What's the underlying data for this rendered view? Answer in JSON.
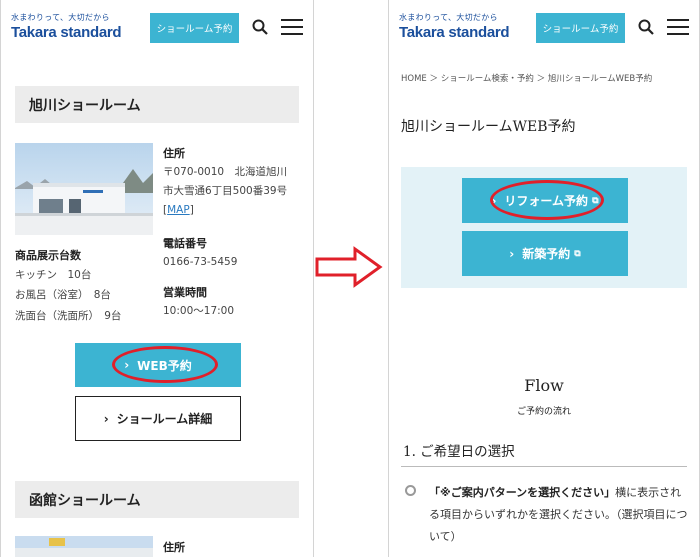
{
  "header": {
    "tagline": "水まわりって、大切だから",
    "logo": "Takara standard",
    "reserve_button": "ショールーム予約"
  },
  "left": {
    "showrooms": [
      {
        "title": "旭川ショールーム",
        "address_label": "住所",
        "address_lines": [
          "〒070-0010　北海道旭川",
          "市大雪通6丁目500番39号"
        ],
        "map_link": "MAP",
        "phone_label": "電話番号",
        "phone": "0166-73-5459",
        "hours_label": "営業時間",
        "hours": "10:00〜17:00",
        "display_label": "商品展示台数",
        "display_items": [
          "キッチン　10台",
          "お風呂（浴室）　8台",
          "洗面台（洗面所）　9台"
        ]
      },
      {
        "title": "函館ショールーム",
        "address_label": "住所"
      }
    ],
    "web_reserve_button": "WEB予約",
    "detail_button": "ショールーム詳細"
  },
  "right": {
    "breadcrumb": "HOME ＞ ショールーム検索・予約 ＞ 旭川ショールームWEB予約",
    "page_title": "旭川ショールームWEB予約",
    "reform_button": "リフォーム予約",
    "newbuild_button": "新築予約",
    "flow_title": "Flow",
    "flow_subtitle": "ご予約の流れ",
    "step_title": "1.  ご希望日の選択",
    "instruction_bold": "「※ご案内パターンを選択ください」",
    "instruction_rest": "横に表示される項目からいずれかを選択ください。（選択項目について）"
  },
  "colors": {
    "accent": "#3cb4d2",
    "brand": "#1b4f9c",
    "highlight": "#e0202a",
    "panel": "#e3f2f7"
  }
}
